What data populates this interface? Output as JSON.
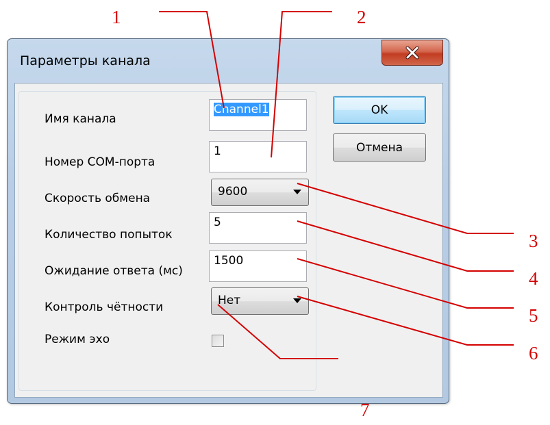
{
  "dialog": {
    "title": "Параметры канала",
    "close_glyph": "✕",
    "ok_label": "OK",
    "cancel_label": "Отмена"
  },
  "fields": {
    "channel_name": {
      "label": "Имя канала",
      "value": "Channel1"
    },
    "com_port": {
      "label": "Номер COM-порта",
      "value": "1"
    },
    "baud_rate": {
      "label": "Скорость обмена",
      "value": "9600"
    },
    "attempts": {
      "label": "Количество попыток",
      "value": "5"
    },
    "timeout": {
      "label": "Ожидание ответа (мс)",
      "value": "1500"
    },
    "parity": {
      "label": "Контроль чётности",
      "value": "Нет"
    },
    "echo": {
      "label": "Режим эхо",
      "checked": false
    }
  },
  "callouts": [
    "1",
    "2",
    "3",
    "4",
    "5",
    "6",
    "7"
  ],
  "colors": {
    "callout": "#d40000",
    "selection": "#3399ff",
    "close_button": "#c8442b"
  }
}
